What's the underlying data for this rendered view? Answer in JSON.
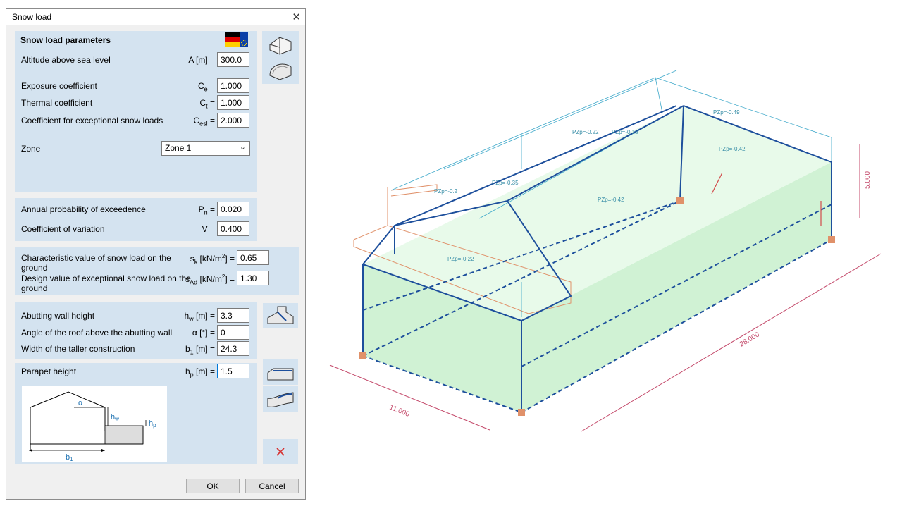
{
  "dialog": {
    "title": "Snow load",
    "params_heading": "Snow load parameters",
    "rows": {
      "altitude": {
        "label": "Altitude above sea level",
        "symbol": "A [m] =",
        "value": "300.0"
      },
      "exposure": {
        "label": "Exposure coefficient",
        "symbol": "C",
        "sub": "e",
        "eq": " =",
        "value": "1.000"
      },
      "thermal": {
        "label": "Thermal coefficient",
        "symbol": "C",
        "sub": "t",
        "eq": " =",
        "value": "1.000"
      },
      "exceptional": {
        "label": "Coefficient for exceptional snow loads",
        "symbol": "C",
        "sub": "esl",
        "eq": " =",
        "value": "2.000"
      },
      "zone": {
        "label": "Zone",
        "value": "Zone 1"
      },
      "annual": {
        "label": "Annual probability of exceedence",
        "symbol": "P",
        "sub": "n",
        "eq": " =",
        "value": "0.020"
      },
      "variation": {
        "label": "Coefficient of variation",
        "symbol": "V =",
        "value": "0.400"
      },
      "sk": {
        "label_line1": "Characteristic value of snow load on the",
        "label_line2": "ground",
        "symbol": "s",
        "sub": "k",
        "unit": " [kN/m",
        "sup": "2",
        "eq": "] =",
        "value": "0.65"
      },
      "sad": {
        "label_line1": "Design value of exceptional snow load on the",
        "label_line2": "ground",
        "symbol": "s",
        "sub": "Ad",
        "unit": " [kN/m",
        "sup": "2",
        "eq": "] =",
        "value": "1.30"
      },
      "wall_height": {
        "label": "Abutting wall height",
        "symbol": "h",
        "sub": "w",
        "eq": " [m] =",
        "value": "3.3"
      },
      "roof_angle": {
        "label": "Angle of the roof above the abutting wall",
        "symbol": "α [°] =",
        "value": "0"
      },
      "width_taller": {
        "label": "Width of the taller construction",
        "symbol": "b",
        "sub": "1",
        "eq": " [m] =",
        "value": "24.3"
      },
      "parapet": {
        "label": "Parapet height",
        "symbol": "h",
        "sub": "p",
        "eq": " [m] =",
        "value": "1.5"
      }
    },
    "sketch": {
      "alpha": "α",
      "hw": "h",
      "hw_sub": "w",
      "hp": "h",
      "hp_sub": "p",
      "b1": "b",
      "b1_sub": "1"
    },
    "ok_label": "OK",
    "cancel_label": "Cancel"
  },
  "model": {
    "tags": {
      "t1": "PZp=-0.49",
      "t2": "PZp=-0.42",
      "t3": "PZp=-0.22",
      "t4": "PZp=-0.15",
      "t5": "PZp=-0.35",
      "t6": "PZp=-0.42",
      "t7": "PZp=-0.2",
      "t8": "PZp=-0.22"
    },
    "dims": {
      "length": "28.000",
      "width": "11.000",
      "height": "5.000"
    }
  },
  "colors": {
    "group_bg": "#d4e3f0",
    "frame_blue": "#1d4f9c",
    "snow_cyan": "#3ba7c9",
    "wall_green": "#c8f0cc",
    "dim_red": "#c44a6b",
    "parapet_orange": "#e0916a"
  }
}
